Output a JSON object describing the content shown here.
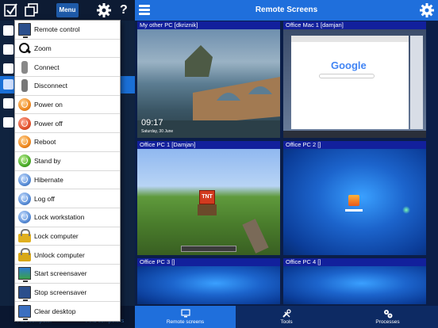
{
  "left_pane": {
    "menu_button_label": "Menu",
    "help_label": "?",
    "bottom_left_text": "Add computer",
    "bottom_right_text": "Find computers"
  },
  "menu": {
    "items": [
      {
        "label": "Remote control",
        "icon": "remote-control-icon"
      },
      {
        "label": "Zoom",
        "icon": "zoom-icon"
      },
      {
        "label": "Connect",
        "icon": "connect-icon"
      },
      {
        "label": "Disconnect",
        "icon": "disconnect-icon"
      },
      {
        "label": "Power on",
        "icon": "power-on-icon"
      },
      {
        "label": "Power off",
        "icon": "power-off-icon"
      },
      {
        "label": "Reboot",
        "icon": "reboot-icon"
      },
      {
        "label": "Stand by",
        "icon": "stand-by-icon"
      },
      {
        "label": "Hibernate",
        "icon": "hibernate-icon"
      },
      {
        "label": "Log off",
        "icon": "log-off-icon"
      },
      {
        "label": "Lock workstation",
        "icon": "lock-workstation-icon"
      },
      {
        "label": "Lock computer",
        "icon": "lock-computer-icon"
      },
      {
        "label": "Unlock computer",
        "icon": "unlock-computer-icon"
      },
      {
        "label": "Start screensaver",
        "icon": "start-screensaver-icon"
      },
      {
        "label": "Stop screensaver",
        "icon": "stop-screensaver-icon"
      },
      {
        "label": "Clear desktop",
        "icon": "clear-desktop-icon"
      }
    ]
  },
  "header": {
    "title": "Remote Screens"
  },
  "tiles": [
    {
      "title": "My other PC [dkriznik]",
      "lock_time": "09:17",
      "lock_date": "Saturday, 30 June"
    },
    {
      "title": "Office Mac 1 [damjan]",
      "search_text": "Google"
    },
    {
      "title": "Office PC 1 [Damjan]",
      "game_block_text": "TNT"
    },
    {
      "title": "Office PC 2 []"
    },
    {
      "title": "Office PC 3 []"
    },
    {
      "title": "Office PC 4 []"
    }
  ],
  "tabs": [
    {
      "label": "Remote screens",
      "active": true
    },
    {
      "label": "Tools",
      "active": false
    },
    {
      "label": "Processes",
      "active": false
    }
  ]
}
